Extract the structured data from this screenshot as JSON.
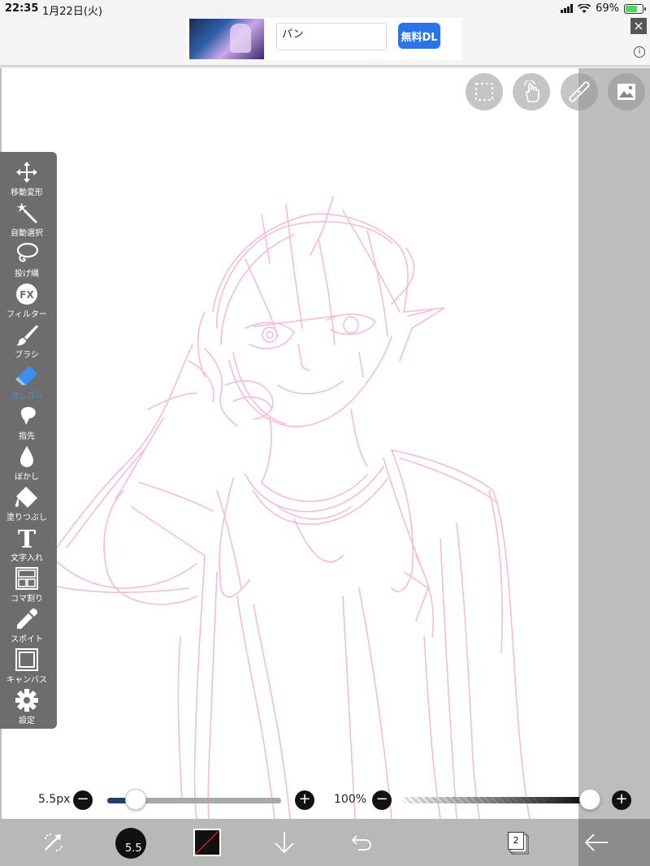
{
  "status_bar": {
    "time": "22:35",
    "date": "1月22日(火)",
    "battery_text": "69%",
    "battery_level": 0.69
  },
  "ad": {
    "title": "パン",
    "cta": "無料DL",
    "close": "×",
    "info": "i"
  },
  "top_buttons": [
    "selection-icon",
    "touch-gesture-icon",
    "ruler-icon",
    "reference-image-icon"
  ],
  "toolbar": {
    "items": [
      {
        "label": "移動変形",
        "icon": "move-transform-icon"
      },
      {
        "label": "自動選択",
        "icon": "magic-wand-icon"
      },
      {
        "label": "投げ縄",
        "icon": "lasso-icon"
      },
      {
        "label": "フィルター",
        "icon": "filter-fx-icon"
      },
      {
        "label": "ブラシ",
        "icon": "brush-icon"
      },
      {
        "label": "消しゴム",
        "icon": "eraser-icon",
        "active": true
      },
      {
        "label": "指先",
        "icon": "smudge-icon"
      },
      {
        "label": "ぼかし",
        "icon": "blur-drop-icon"
      },
      {
        "label": "塗りつぶし",
        "icon": "bucket-fill-icon"
      },
      {
        "label": "文字入れ",
        "icon": "text-icon"
      },
      {
        "label": "コマ割り",
        "icon": "panel-divide-icon"
      },
      {
        "label": "スポイト",
        "icon": "eyedropper-icon"
      },
      {
        "label": "キャンバス",
        "icon": "canvas-icon"
      },
      {
        "label": "設定",
        "icon": "gear-icon"
      }
    ],
    "fx_text": "FX",
    "text_glyph": "T"
  },
  "brush_size": {
    "label": "5.5px",
    "value_fraction": 0.11
  },
  "opacity": {
    "label": "100%",
    "value_fraction": 1.0
  },
  "controls": {
    "minus": "−",
    "plus": "+"
  },
  "bottom_bar": {
    "brush_size_label": "5.5",
    "layer_count": "2"
  },
  "colors": {
    "sketch_stroke": "#f7b7d8",
    "accent": "#3b8ff0",
    "toolbar_bg": "#6d6d6d"
  }
}
